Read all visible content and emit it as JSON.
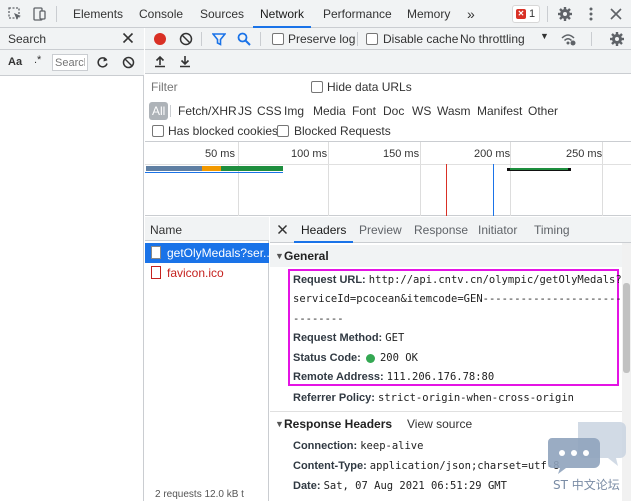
{
  "toptabs": [
    "Elements",
    "Console",
    "Sources",
    "Network",
    "Performance",
    "Memory"
  ],
  "more_tabs": "»",
  "error_count": "1",
  "search": {
    "title": "Search",
    "aa": "Aa",
    "regex": ".*",
    "placeholder": "Search"
  },
  "toolbar": {
    "preserve_log": "Preserve log",
    "disable_cache": "Disable cache",
    "throttling": "No throttling"
  },
  "filter": {
    "placeholder": "Filter",
    "hide_data_urls": "Hide data URLs",
    "types": [
      "All",
      "Fetch/XHR",
      "JS",
      "CSS",
      "Img",
      "Media",
      "Font",
      "Doc",
      "WS",
      "Wasm",
      "Manifest",
      "Other"
    ],
    "has_blocked_cookies": "Has blocked cookies",
    "blocked_requests": "Blocked Requests"
  },
  "overview": {
    "ticks": [
      "50 ms",
      "100 ms",
      "150 ms",
      "200 ms",
      "250 ms"
    ]
  },
  "request_list": {
    "header": "Name",
    "rows": [
      {
        "name": "getOlyMedals?ser..."
      },
      {
        "name": "favicon.ico"
      }
    ],
    "status": "2 requests   12.0 kB t"
  },
  "details": {
    "tabs": [
      "Headers",
      "Preview",
      "Response",
      "Initiator",
      "Timing"
    ],
    "general_title": "General",
    "request_url_key": "Request URL:",
    "request_url_line1": "http://api.cntv.cn/olympic/getOlyMedals?",
    "request_url_line2": "serviceId=pcocean&itemcode=GEN-----------------------",
    "request_url_line3": "--------",
    "request_method_key": "Request Method:",
    "request_method": "GET",
    "status_code_key": "Status Code:",
    "status_code": "200 OK",
    "remote_address_key": "Remote Address:",
    "remote_address": "111.206.176.78:80",
    "referrer_policy_key": "Referrer Policy:",
    "referrer_policy": "strict-origin-when-cross-origin",
    "response_headers_title": "Response Headers",
    "view_source": "View source",
    "connection_key": "Connection:",
    "connection": "keep-alive",
    "content_type_key": "Content-Type:",
    "content_type": "application/json;charset=utf-8",
    "date_key": "Date:",
    "date": "Sat, 07 Aug 2021 06:51:29 GMT"
  },
  "watermark": "ST 中文论坛",
  "colors": {
    "accent": "#1a73e8",
    "highlight": "#e414e4",
    "status_ok": "#34a853",
    "record": "#d93025",
    "error_link": "#c5221f"
  }
}
